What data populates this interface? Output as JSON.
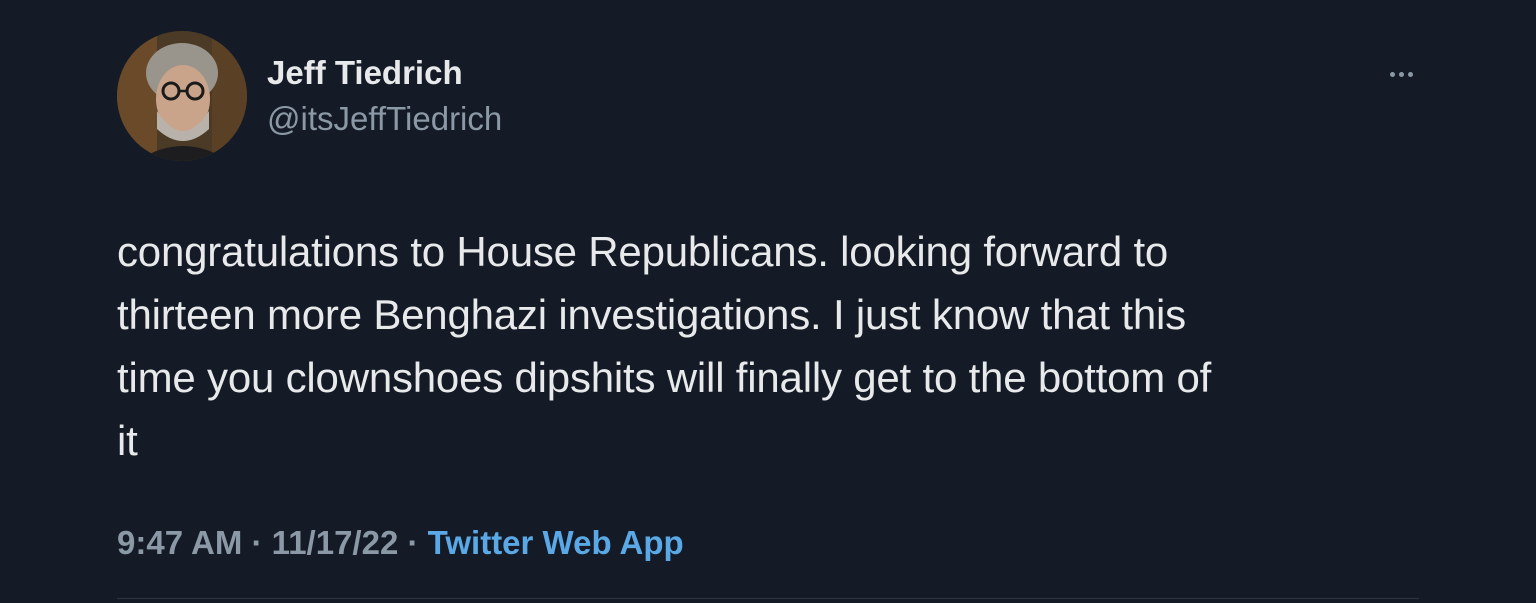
{
  "author": {
    "display_name": "Jeff Tiedrich",
    "handle": "@itsJeffTiedrich",
    "avatar_icon": "profile-photo"
  },
  "tweet": {
    "text": "congratulations to House Republicans. looking forward to\nthirteen more Benghazi investigations. I just know that this\ntime you clownshoes dipshits will finally get to the bottom of\nit",
    "time": "9:47 AM",
    "separator": "·",
    "date": "11/17/22",
    "source": "Twitter Web App"
  },
  "colors": {
    "background": "#151b26",
    "primary_text": "#e7e9ea",
    "secondary_text": "#8b98a5",
    "link": "#5aa9e6"
  },
  "icons": {
    "more": "more-horizontal-icon"
  }
}
